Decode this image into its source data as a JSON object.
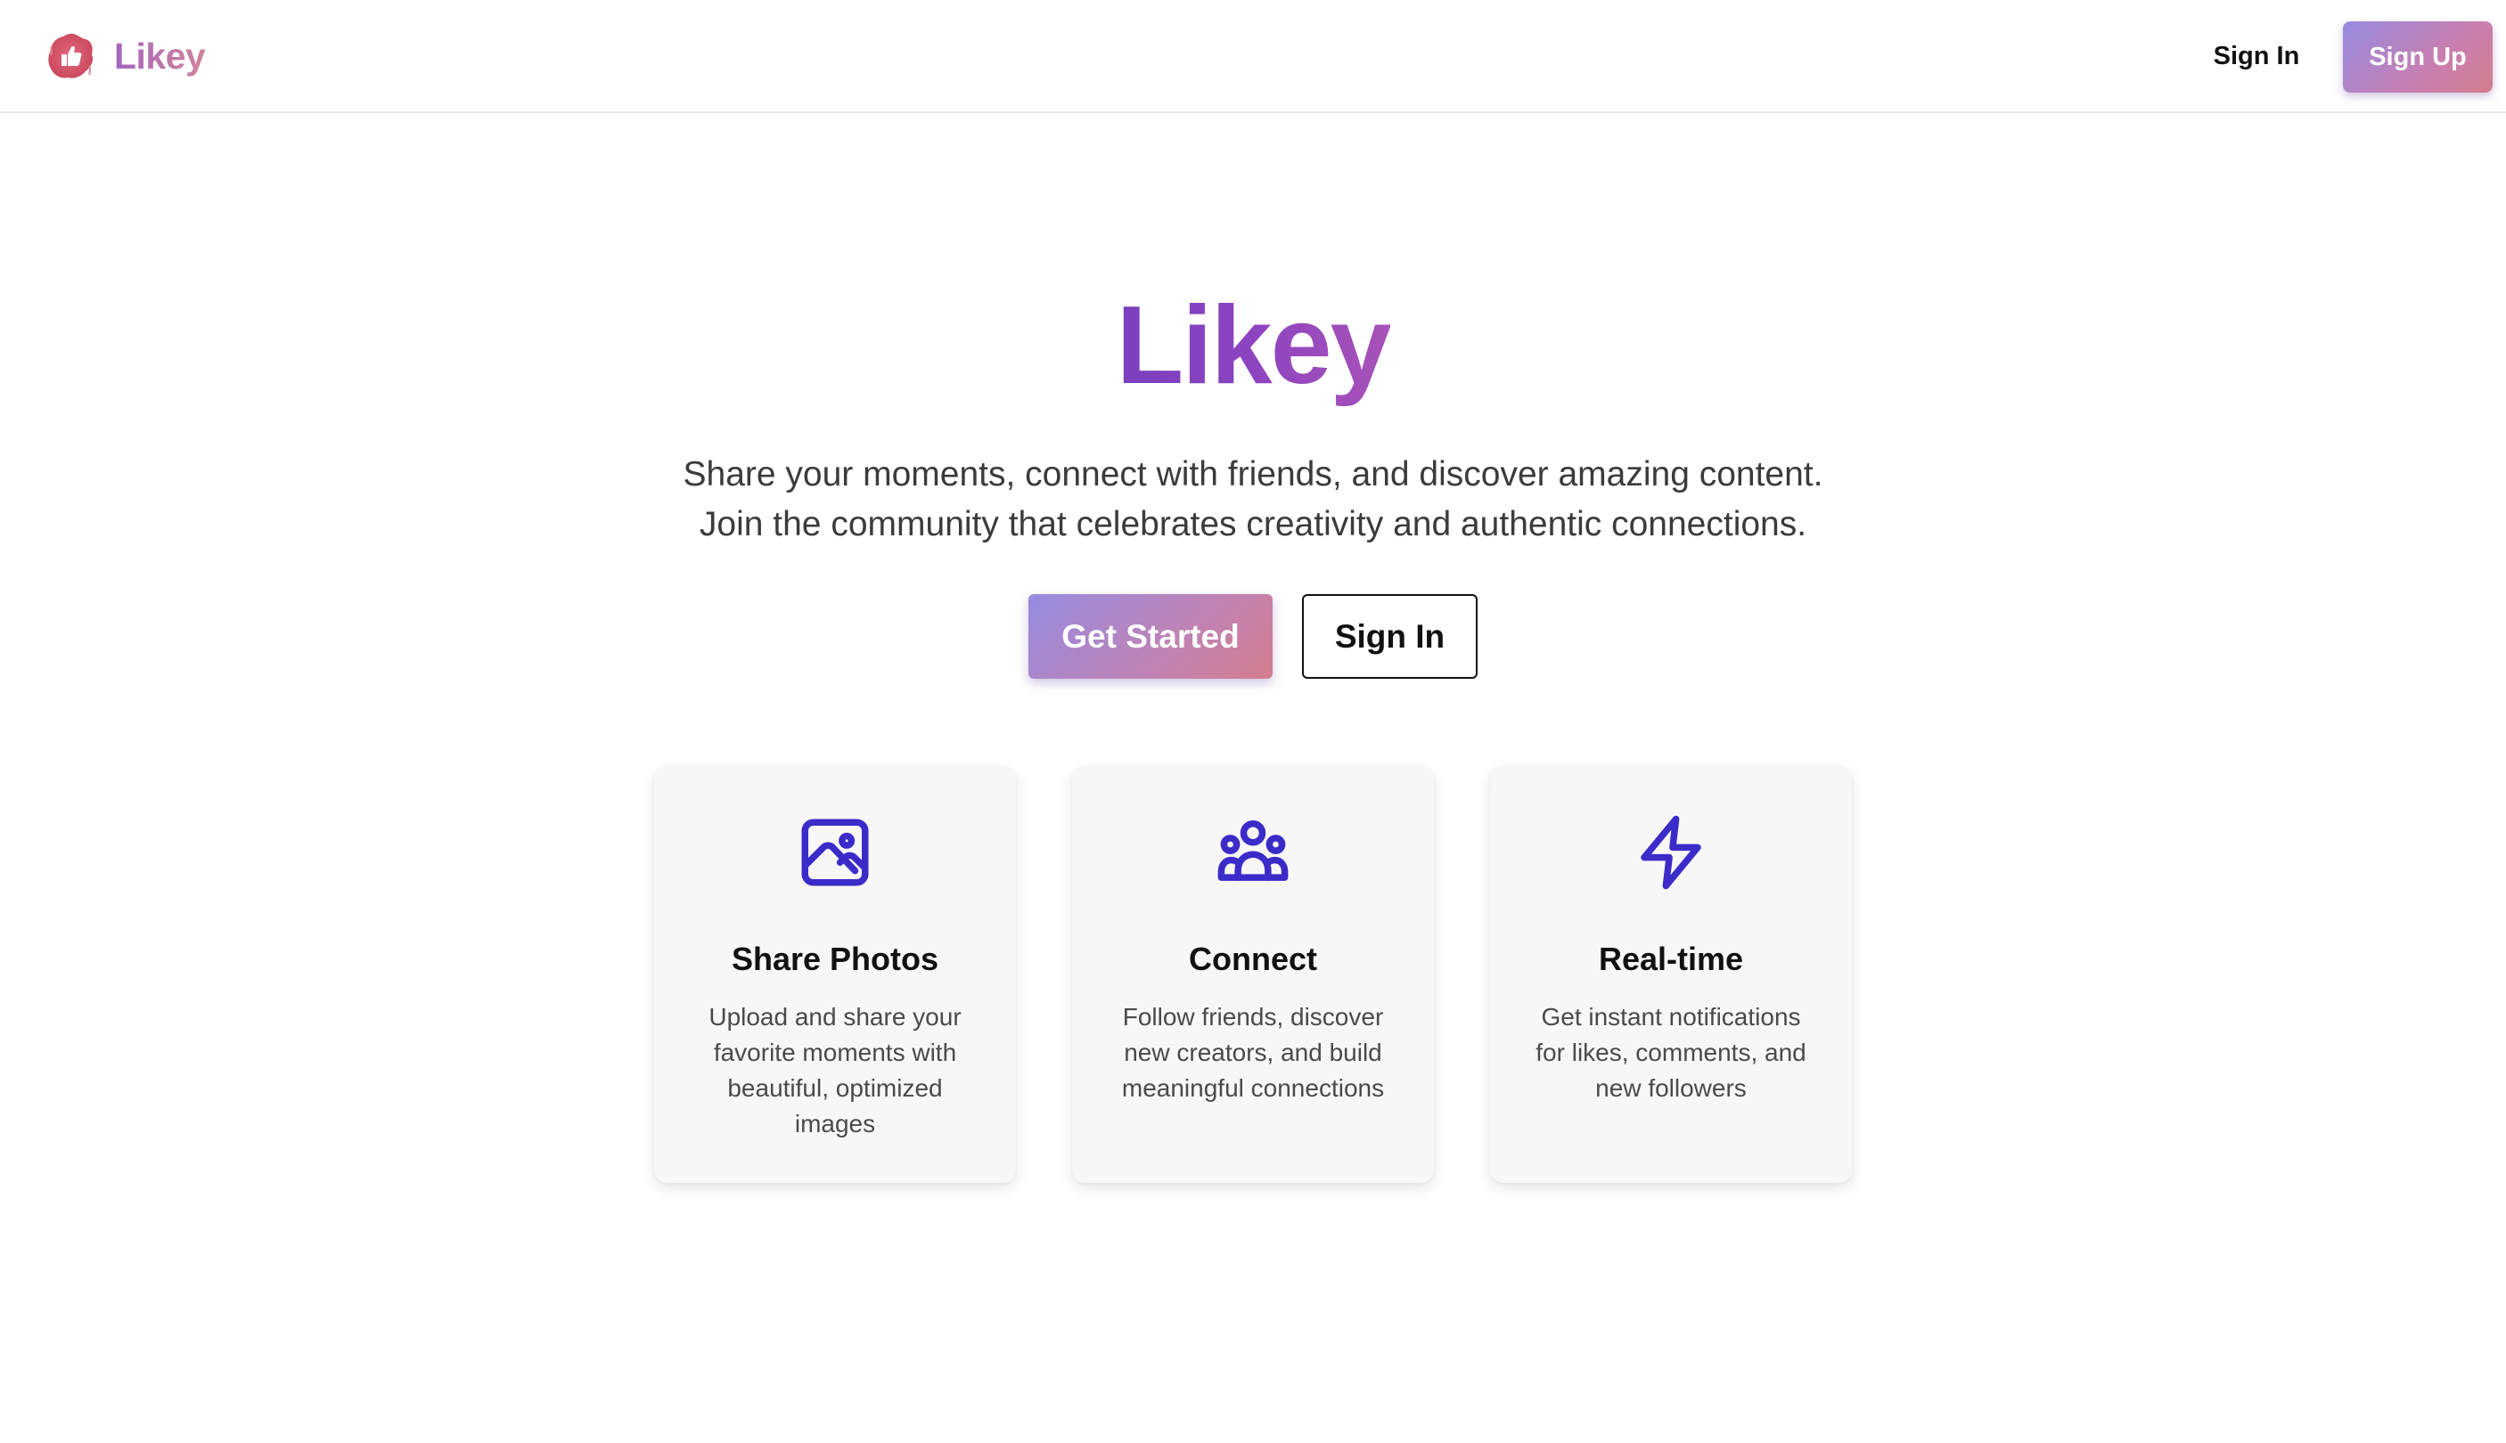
{
  "header": {
    "brand_name": "Likey",
    "brand_icon": "thumbs-up-logo-icon",
    "nav_sign_in": "Sign In",
    "nav_sign_up": "Sign Up"
  },
  "hero": {
    "title": "Likey",
    "subtitle_line1": "Share your moments, connect with friends, and discover amazing content.",
    "subtitle_line2": "Join the community that celebrates creativity and authentic connections.",
    "primary_cta": "Get Started",
    "secondary_cta": "Sign In"
  },
  "features": [
    {
      "icon": "image-icon",
      "title": "Share Photos",
      "description": "Upload and share your favorite moments with beautiful, optimized images"
    },
    {
      "icon": "users-group-icon",
      "title": "Connect",
      "description": "Follow friends, discover new creators, and build meaningful connections"
    },
    {
      "icon": "lightning-bolt-icon",
      "title": "Real-time",
      "description": "Get instant notifications for likes, comments, and new followers"
    }
  ],
  "colors": {
    "brand_gradient_start": "#968be0",
    "brand_gradient_end": "#d47d8e",
    "hero_title": "#8d44c0",
    "feature_icon": "#3b2bc9",
    "card_background": "#f7f7f8"
  }
}
